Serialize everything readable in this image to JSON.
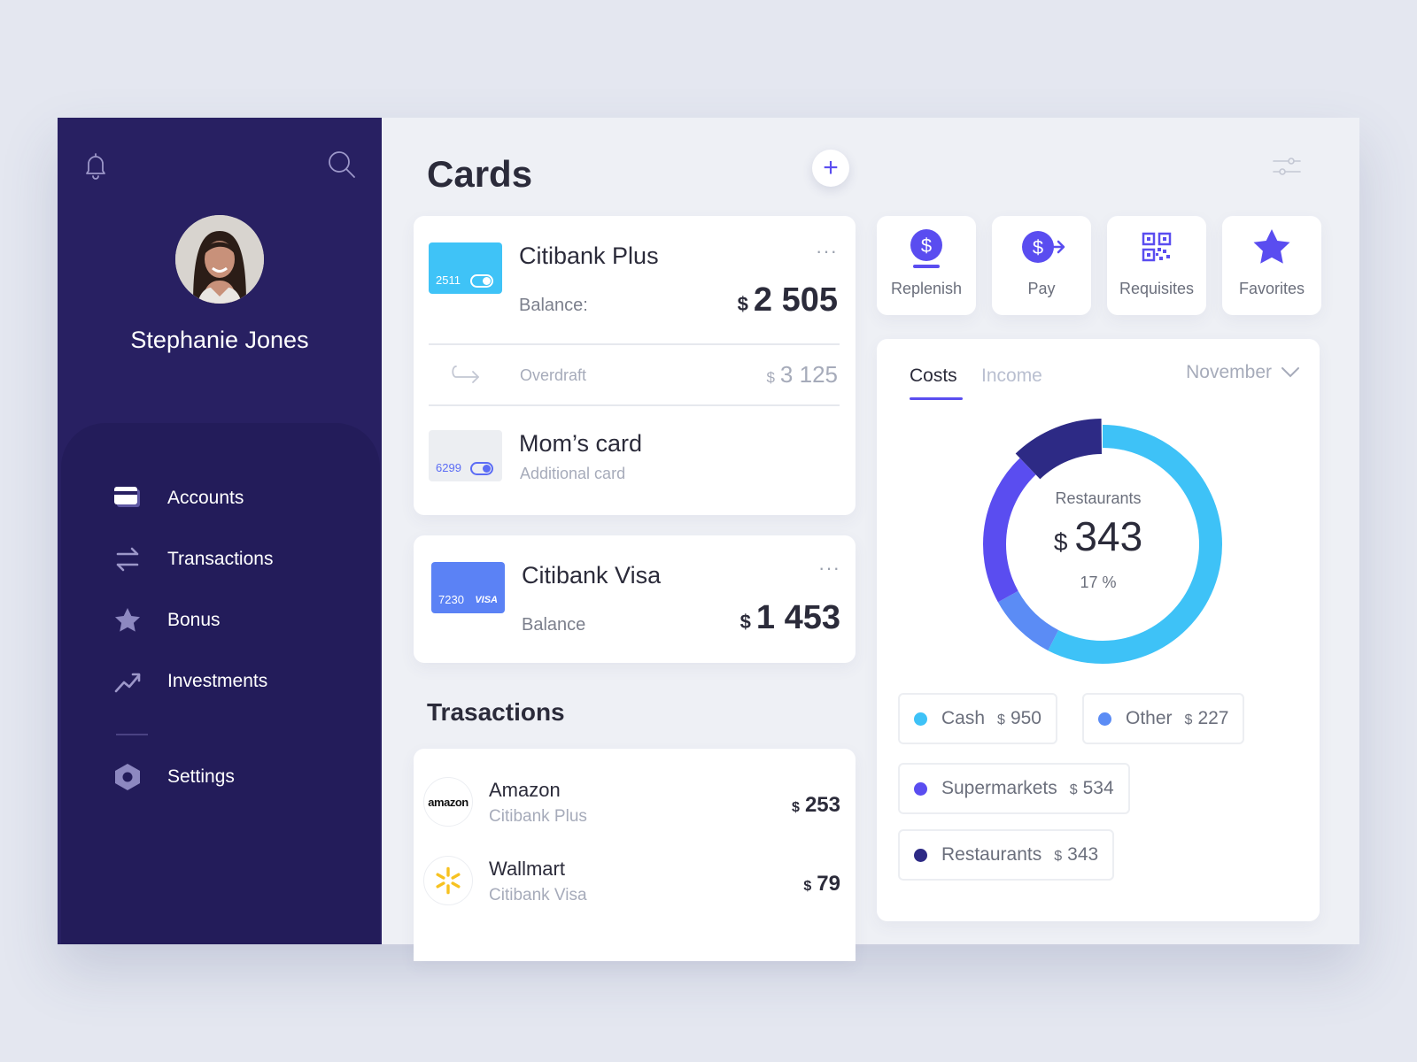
{
  "user": {
    "name": "Stephanie Jones"
  },
  "sidebar": {
    "items": [
      {
        "label": "Accounts",
        "icon": "card-icon"
      },
      {
        "label": "Transactions",
        "icon": "transfer-arrows-icon"
      },
      {
        "label": "Bonus",
        "icon": "star-icon"
      },
      {
        "label": "Investments",
        "icon": "trend-up-icon"
      },
      {
        "label": "Settings",
        "icon": "hexagon-gear-icon"
      }
    ]
  },
  "page": {
    "title": "Cards",
    "transactions_title": "Trasactions"
  },
  "cards": {
    "main": {
      "number": "2511",
      "name": "Citibank Plus",
      "balance_label": "Balance:",
      "currency": "$",
      "balance": "2 505",
      "overdraft_label": "Overdraft",
      "overdraft_value": "3 125"
    },
    "additional": {
      "number": "6299",
      "name": "Mom’s card",
      "subtitle": "Additional card"
    },
    "visa": {
      "number": "7230",
      "brand": "VISA",
      "name": "Citibank Visa",
      "balance_label": "Balance",
      "currency": "$",
      "balance": "1 453"
    }
  },
  "transactions": [
    {
      "merchant": "Amazon",
      "logo_text": "amazon",
      "card": "Citibank Plus",
      "currency": "$",
      "amount": "253"
    },
    {
      "merchant": "Wallmart",
      "card": "Citibank Visa",
      "currency": "$",
      "amount": "79"
    }
  ],
  "actions": [
    {
      "label": "Replenish",
      "icon": "dollar-coin-icon"
    },
    {
      "label": "Pay",
      "icon": "dollar-arrow-icon"
    },
    {
      "label": "Requisites",
      "icon": "qr-code-icon"
    },
    {
      "label": "Favorites",
      "icon": "star-icon"
    }
  ],
  "stats": {
    "tabs": [
      "Costs",
      "Income"
    ],
    "active_tab": "Costs",
    "month": "November",
    "highlight": {
      "category": "Restaurants",
      "currency": "$",
      "amount": "343",
      "percent": "17 %"
    },
    "legend": [
      {
        "name": "Cash",
        "currency": "$",
        "amount": "950",
        "color": "#3ec2f7"
      },
      {
        "name": "Other",
        "currency": "$",
        "amount": "227",
        "color": "#5b8cf5"
      },
      {
        "name": "Supermarkets",
        "currency": "$",
        "amount": "534",
        "color": "#5a4df0"
      },
      {
        "name": "Restaurants",
        "currency": "$",
        "amount": "343",
        "color": "#2d2a85"
      }
    ]
  },
  "colors": {
    "sidebar": "#282062",
    "accent": "#5a4df0",
    "cash": "#3ec2f7",
    "other": "#5b8cf5",
    "supermarkets": "#5a4df0",
    "restaurants": "#2d2a85"
  }
}
